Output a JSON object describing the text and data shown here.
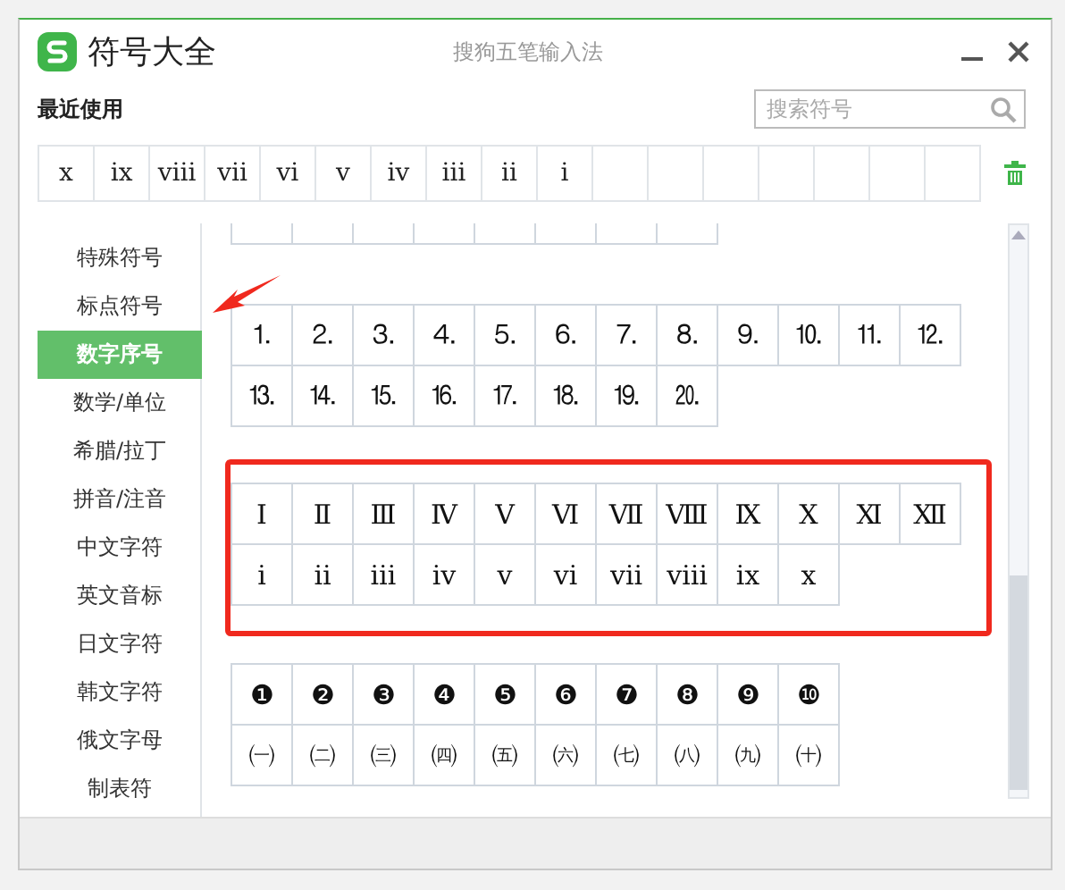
{
  "window": {
    "title": "符号大全",
    "subtitle": "搜狗五笔输入法"
  },
  "recent": {
    "label": "最近使用",
    "search": {
      "placeholder": "搜索符号"
    },
    "symbols": [
      "ⅹ",
      "ⅸ",
      "ⅷ",
      "ⅶ",
      "ⅵ",
      "ⅴ",
      "ⅳ",
      "ⅲ",
      "ⅱ",
      "ⅰ"
    ]
  },
  "sidebar": {
    "items": [
      {
        "label": "特殊符号",
        "selected": false
      },
      {
        "label": "标点符号",
        "selected": false
      },
      {
        "label": "数字序号",
        "selected": true
      },
      {
        "label": "数学/单位",
        "selected": false
      },
      {
        "label": "希腊/拉丁",
        "selected": false
      },
      {
        "label": "拼音/注音",
        "selected": false
      },
      {
        "label": "中文字符",
        "selected": false
      },
      {
        "label": "英文音标",
        "selected": false
      },
      {
        "label": "日文字符",
        "selected": false
      },
      {
        "label": "韩文字符",
        "selected": false
      },
      {
        "label": "俄文字母",
        "selected": false
      },
      {
        "label": "制表符",
        "selected": false
      }
    ]
  },
  "groups": [
    {
      "highlighted": false,
      "rows": [
        [
          "⒈",
          "⒉",
          "⒊",
          "⒋",
          "⒌",
          "⒍",
          "⒎",
          "⒏",
          "⒐",
          "⒑",
          "⒒",
          "⒓"
        ],
        [
          "⒔",
          "⒕",
          "⒖",
          "⒗",
          "⒘",
          "⒙",
          "⒚",
          "⒛"
        ]
      ]
    },
    {
      "highlighted": true,
      "rows": [
        [
          "Ⅰ",
          "Ⅱ",
          "Ⅲ",
          "Ⅳ",
          "Ⅴ",
          "Ⅵ",
          "Ⅶ",
          "Ⅷ",
          "Ⅸ",
          "Ⅹ",
          "Ⅺ",
          "Ⅻ"
        ],
        [
          "ⅰ",
          "ⅱ",
          "ⅲ",
          "ⅳ",
          "ⅴ",
          "ⅵ",
          "ⅶ",
          "ⅷ",
          "ⅸ",
          "ⅹ"
        ]
      ]
    },
    {
      "highlighted": false,
      "rows": [
        [
          "❶",
          "❷",
          "❸",
          "❹",
          "❺",
          "❻",
          "❼",
          "❽",
          "❾",
          "❿"
        ],
        [
          "㈠",
          "㈡",
          "㈢",
          "㈣",
          "㈤",
          "㈥",
          "㈦",
          "㈧",
          "㈨",
          "㈩"
        ]
      ]
    }
  ]
}
